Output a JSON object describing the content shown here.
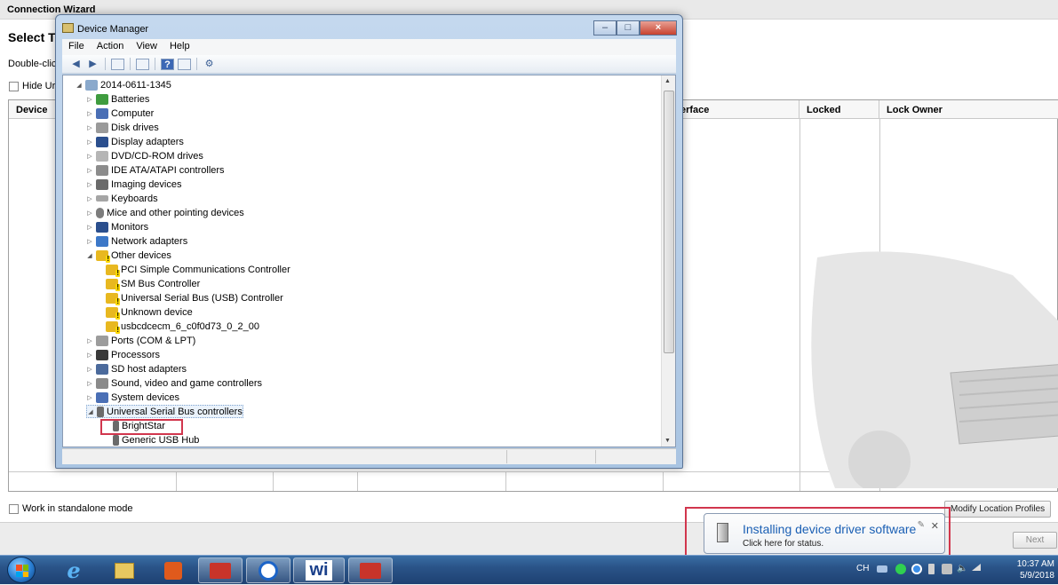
{
  "wizard": {
    "title": "Connection Wizard",
    "heading": "Select T",
    "subtitle": "Double-clic",
    "hide_label": "Hide Ur",
    "columns": [
      "Device",
      "erface",
      "Locked",
      "Lock Owner"
    ],
    "standalone_label": "Work in standalone mode",
    "modify_button": "Modify Location Profiles",
    "next_button": "Next"
  },
  "device_manager": {
    "title": "Device Manager",
    "menu": [
      "File",
      "Action",
      "View",
      "Help"
    ],
    "root": "2014-0611-1345",
    "categories": [
      {
        "label": "Batteries"
      },
      {
        "label": "Computer"
      },
      {
        "label": "Disk drives"
      },
      {
        "label": "Display adapters"
      },
      {
        "label": "DVD/CD-ROM drives"
      },
      {
        "label": "IDE ATA/ATAPI controllers"
      },
      {
        "label": "Imaging devices"
      },
      {
        "label": "Keyboards"
      },
      {
        "label": "Mice and other pointing devices"
      },
      {
        "label": "Monitors"
      },
      {
        "label": "Network adapters"
      },
      {
        "label": "Other devices"
      }
    ],
    "other_devices": [
      "PCI Simple Communications Controller",
      "SM Bus Controller",
      "Universal Serial Bus (USB) Controller",
      "Unknown device",
      "usbcdcecm_6_c0f0d73_0_2_00"
    ],
    "categories2": [
      {
        "label": "Ports (COM & LPT)"
      },
      {
        "label": "Processors"
      },
      {
        "label": "SD host adapters"
      },
      {
        "label": "Sound, video and game controllers"
      },
      {
        "label": "System devices"
      },
      {
        "label": "Universal Serial Bus controllers"
      }
    ],
    "usb_children": [
      "BrightStar",
      "Generic USB Hub"
    ]
  },
  "notification": {
    "title": "Installing device driver software",
    "text": "Click here for status."
  },
  "taskbar": {
    "lang": "CH",
    "time": "10:37 AM",
    "date": "5/9/2018"
  }
}
